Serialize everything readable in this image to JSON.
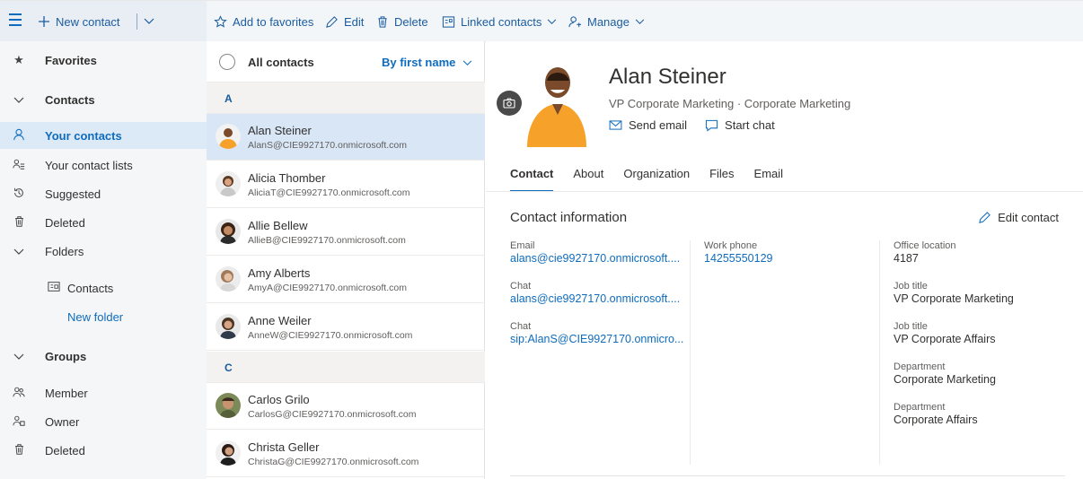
{
  "toolbar": {
    "new_contact": "New contact",
    "add_favorites": "Add to favorites",
    "edit": "Edit",
    "delete": "Delete",
    "linked_contacts": "Linked contacts",
    "manage": "Manage"
  },
  "nav": {
    "favorites": "Favorites",
    "contacts": "Contacts",
    "your_contacts": "Your contacts",
    "your_contact_lists": "Your contact lists",
    "suggested": "Suggested",
    "deleted": "Deleted",
    "folders": "Folders",
    "folder_contacts": "Contacts",
    "new_folder": "New folder",
    "groups": "Groups",
    "member": "Member",
    "owner": "Owner",
    "groups_deleted": "Deleted"
  },
  "list": {
    "all_contacts": "All contacts",
    "sort": "By first name",
    "groups": [
      {
        "letter": "A"
      },
      {
        "letter": "C"
      }
    ],
    "contacts": [
      {
        "name": "Alan Steiner",
        "email": "AlanS@CIE9927170.onmicrosoft.com"
      },
      {
        "name": "Alicia Thomber",
        "email": "AliciaT@CIE9927170.onmicrosoft.com"
      },
      {
        "name": "Allie Bellew",
        "email": "AllieB@CIE9927170.onmicrosoft.com"
      },
      {
        "name": "Amy Alberts",
        "email": "AmyA@CIE9927170.onmicrosoft.com"
      },
      {
        "name": "Anne Weiler",
        "email": "AnneW@CIE9927170.onmicrosoft.com"
      },
      {
        "name": "Carlos Grilo",
        "email": "CarlosG@CIE9927170.onmicrosoft.com"
      },
      {
        "name": "Christa Geller",
        "email": "ChristaG@CIE9927170.onmicrosoft.com"
      }
    ]
  },
  "detail": {
    "name": "Alan Steiner",
    "subtitle": "VP Corporate Marketing · Corporate Marketing",
    "send_email": "Send email",
    "start_chat": "Start chat",
    "tabs": [
      "Contact",
      "About",
      "Organization",
      "Files",
      "Email"
    ],
    "section_title": "Contact information",
    "edit_contact": "Edit contact",
    "col1": [
      {
        "label": "Email",
        "value": "alans@cie9927170.onmicrosoft...."
      },
      {
        "label": "Chat",
        "value": "alans@cie9927170.onmicrosoft...."
      },
      {
        "label": "Chat",
        "value": "sip:AlanS@CIE9927170.onmicro..."
      }
    ],
    "col2": [
      {
        "label": "Work phone",
        "value": "14255550129"
      }
    ],
    "col3": [
      {
        "label": "Office location",
        "value": "4187"
      },
      {
        "label": "Job title",
        "value": "VP Corporate Marketing"
      },
      {
        "label": "Job title",
        "value": "VP Corporate Affairs"
      },
      {
        "label": "Department",
        "value": "Corporate Marketing"
      },
      {
        "label": "Department",
        "value": "Corporate Affairs"
      }
    ]
  },
  "colors": {
    "accent": "#0f6cbd",
    "selected_row": "#d8e6f6",
    "nav_bg": "#f4f6f8"
  }
}
